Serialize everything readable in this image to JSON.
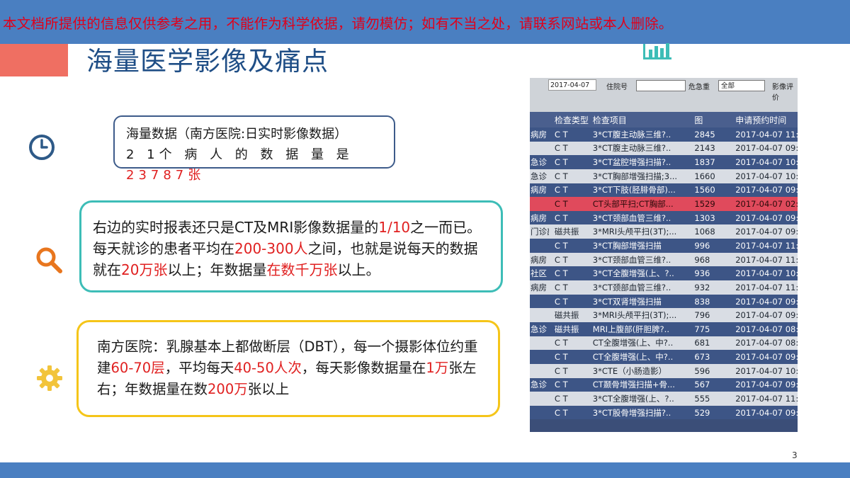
{
  "disclaimer": "本文档所提供的信息仅供参考之用，不能作为科学依据，请勿模仿；如有不当之处，请联系网站或本人删除。",
  "title": "海量医学影像及痛点",
  "box1": {
    "line1": "海量数据（南方医院:日实时影像数据）",
    "line2_prefix": "2 1个 病 人 的 数 据 量 是",
    "line2_value": "23787",
    "line2_suffix": "张"
  },
  "box2": {
    "t1": "右边的实时报表还只是CT及MRI影像数据量的",
    "h1": "1/10",
    "t2": "之一而已。每天就诊的患者平均在",
    "h2": "200-300人",
    "t3": "之间，也就是说每天的数据就在",
    "h3": "20万张",
    "t4": "以上；年数据量",
    "h4": "在数千万张",
    "t5": "以上。"
  },
  "box3": {
    "t1": "南方医院：乳腺基本上都做断层（DBT），每一个摄影体位约重建",
    "h1": "60-70层",
    "t2": "，平均每天",
    "h2": "40-50人次",
    "t3": "，每天影像数据量在",
    "h3": "1万",
    "t4": "张左右；年数据量在数",
    "h4": "200万",
    "t5": "张以上"
  },
  "photo": {
    "toolbar": {
      "date": "2017-04-07",
      "label1": "住院号",
      "label2": "危急重",
      "dept": "全部",
      "label3": "影像评价"
    },
    "headers": [
      "",
      "检查类型",
      "检查项目",
      "图",
      "申请预约时间"
    ],
    "rows": [
      [
        "病房",
        "C T",
        "3*CT腹主动脉三维?..",
        "2845",
        "2017-04-07 11:",
        "odd"
      ],
      [
        "",
        "C T",
        "3*CT腹主动脉三维?..",
        "2143",
        "2017-04-07 09:5",
        "even"
      ],
      [
        "急诊",
        "C T",
        "3*CT盆腔增强扫描?..",
        "1837",
        "2017-04-07 10:5",
        "odd"
      ],
      [
        "急诊",
        "C T",
        "3*CT胸部增强扫描;3...",
        "1660",
        "2017-04-07 10:1",
        "even"
      ],
      [
        "病房",
        "C T",
        "3*CT下肢(胫腓骨部)...",
        "1560",
        "2017-04-07 09:5",
        "odd"
      ],
      [
        "",
        "C T",
        "CT头部平扫;CT胸部...",
        "1529",
        "2017-04-07 02:5",
        "red"
      ],
      [
        "病房",
        "C T",
        "3*CT颈部血管三维?..",
        "1303",
        "2017-04-07 09:5",
        "odd"
      ],
      [
        "门诊部",
        "磁共振",
        "3*MRI头颅平扫(3T);...",
        "1068",
        "2017-04-07 09:0",
        "even"
      ],
      [
        "",
        "C T",
        "3*CT胸部增强扫描",
        "996",
        "2017-04-07 11:2",
        "odd"
      ],
      [
        "病房",
        "C T",
        "3*CT颈部血管三维?..",
        "968",
        "2017-04-07 11:1",
        "even"
      ],
      [
        "社区",
        "C T",
        "3*CT全腹增强(上、?..",
        "936",
        "2017-04-07 10:0",
        "odd"
      ],
      [
        "病房",
        "C T",
        "3*CT颈部血管三维?..",
        "932",
        "2017-04-07 11:1",
        "even"
      ],
      [
        "",
        "C T",
        "3*CT双肾增强扫描",
        "838",
        "2017-04-07 09:5",
        "odd"
      ],
      [
        "",
        "磁共振",
        "3*MRI头颅平扫(3T);...",
        "796",
        "2017-04-07 09:4",
        "even"
      ],
      [
        "急诊",
        "磁共振",
        "MRI上腹部(肝胆脾?..",
        "775",
        "2017-04-07 08:1",
        "odd"
      ],
      [
        "",
        "C T",
        "CT全腹增强(上、中?..",
        "681",
        "2017-04-07 08:5",
        "even"
      ],
      [
        "",
        "C T",
        "CT全腹增强(上、中?..",
        "673",
        "2017-04-07 09:5",
        "odd"
      ],
      [
        "",
        "C T",
        "3*CTE（小肠造影）",
        "596",
        "2017-04-07 10:4",
        "even"
      ],
      [
        "急诊",
        "C T",
        "CT颞骨增强扫描+骨...",
        "567",
        "2017-04-07 09:3",
        "odd"
      ],
      [
        "",
        "C T",
        "3*CT全腹增强(上、?..",
        "555",
        "2017-04-07 11:5",
        "even"
      ],
      [
        "",
        "C T",
        "3*CT股骨增强扫描?..",
        "529",
        "2017-04-07 09:4",
        "odd"
      ]
    ]
  },
  "page_number": "3",
  "icons": {
    "clock": "clock-icon",
    "search": "search-icon",
    "gear": "gear-icon",
    "chart": "bar-chart-icon"
  },
  "colors": {
    "bar": "#4a7fc1",
    "accent": "#ef6f62",
    "title": "#1f4e86",
    "highlight": "#e02020",
    "teal": "#3dbdb7",
    "yellow": "#f5c519",
    "navy": "#3d5b8a"
  }
}
